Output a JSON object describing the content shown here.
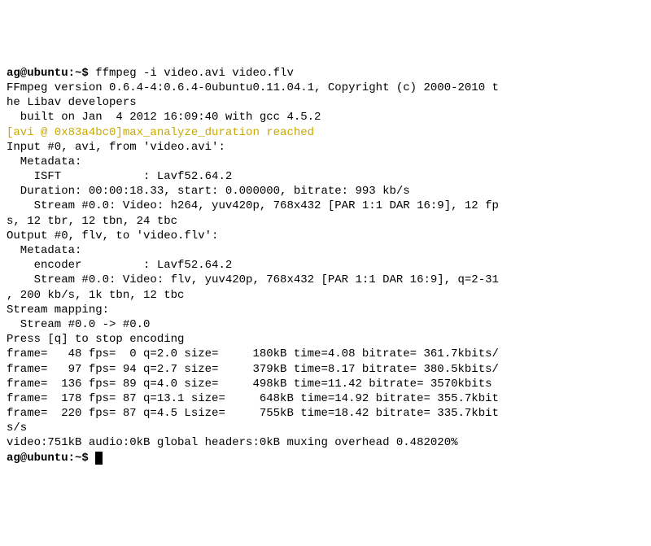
{
  "prompt1": "ag@ubuntu:~$ ",
  "command": "ffmpeg -i video.avi video.flv",
  "line_version": "FFmpeg version 0.6.4-4:0.6.4-0ubuntu0.11.04.1, Copyright (c) 2000-2010 t",
  "line_version2": "he Libav developers",
  "line_built": "  built on Jan  4 2012 16:09:40 with gcc 4.5.2",
  "warning_line": "[avi @ 0x83a4bc0]max_analyze_duration reached",
  "input_line": "Input #0, avi, from 'video.avi':",
  "meta1": "  Metadata:",
  "isft": "    ISFT            : Lavf52.64.2",
  "duration": "  Duration: 00:00:18.33, start: 0.000000, bitrate: 993 kb/s",
  "stream_in1": "    Stream #0.0: Video: h264, yuv420p, 768x432 [PAR 1:1 DAR 16:9], 12 fp",
  "stream_in2": "s, 12 tbr, 12 tbn, 24 tbc",
  "output_line": "Output #0, flv, to 'video.flv':",
  "meta2": "  Metadata:",
  "encoder": "    encoder         : Lavf52.64.2",
  "stream_out1": "    Stream #0.0: Video: flv, yuv420p, 768x432 [PAR 1:1 DAR 16:9], q=2-31",
  "stream_out2": ", 200 kb/s, 1k tbn, 12 tbc",
  "mapping1": "Stream mapping:",
  "mapping2": "  Stream #0.0 -> #0.0",
  "press_q": "Press [q] to stop encoding",
  "frame1": "frame=   48 fps=  0 q=2.0 size=     180kB time=4.08 bitrate= 361.7kbits/",
  "frame2": "frame=   97 fps= 94 q=2.7 size=     379kB time=8.17 bitrate= 380.5kbits/",
  "frame3a": "frame=  136 fps= 89 q=4.0 size=     498kB time=11.42 bitrate= 35",
  "frame3b": ".0kbits",
  "frame4": "frame=  178 fps= 87 q=13.1 size=     648kB time=14.92 bitrate= 355.7kbit",
  "frame5": "frame=  220 fps= 87 q=4.5 Lsize=     755kB time=18.42 bitrate= 335.7kbit",
  "ss": "s/s",
  "summary": "video:751kB audio:0kB global headers:0kB muxing overhead 0.482020%",
  "prompt2": "ag@ubuntu:~$ "
}
